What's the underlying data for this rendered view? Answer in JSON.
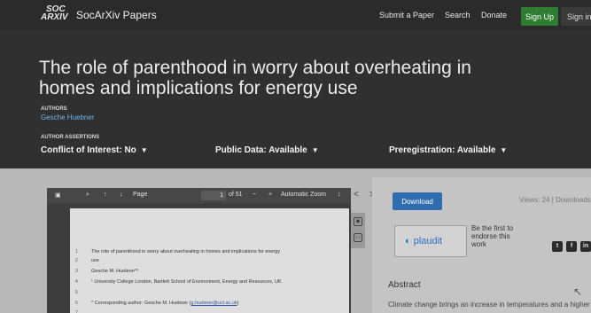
{
  "nav": {
    "logo_top": "SOC",
    "logo_bottom": "ARXIV",
    "brand": "SocArXiv Papers",
    "links": [
      "Submit a Paper",
      "Search",
      "Donate"
    ],
    "signup": "Sign Up",
    "signin": "Sign in"
  },
  "header": {
    "title": "The role of parenthood in worry about overheating in homes and implications for energy use",
    "authors_heading": "AUTHORS",
    "author": "Gesche Huebner",
    "assertions_heading": "AUTHOR ASSERTIONS",
    "assertions": [
      "Conflict of Interest: No",
      "Public Data: Available",
      "Preregistration: Available"
    ]
  },
  "viewer": {
    "page_label": "Page",
    "page_num": "1",
    "page_total": "of 51",
    "zoom": "Automatic Zoom",
    "doc_lines": [
      {
        "n": "1",
        "text": "The role of parenthood in worry about overheating in homes and implications for energy"
      },
      {
        "n": "2",
        "text": "use"
      },
      {
        "n": "3",
        "text": "Gesche M. Huebner*¹"
      },
      {
        "n": "4",
        "text": "¹ University College London, Bartlett School of Environment, Energy and Resources, UK"
      },
      {
        "n": "5",
        "text": ""
      },
      {
        "n": "6",
        "text": "* Corresponding author: Gesche M. Huebner"
      },
      {
        "n": "7",
        "text": ""
      }
    ],
    "email": "g.huebner@ucl.ac.uk"
  },
  "side": {
    "download": "Download",
    "views": "Views: 24 | Downloads",
    "plaudit": "plaudit",
    "endorse": "Be the first to endorse this work",
    "abstract_heading": "Abstract",
    "abstract_text": "Climate change brings an increase in temperatures and a higher"
  }
}
